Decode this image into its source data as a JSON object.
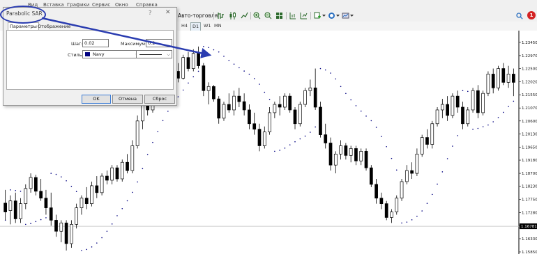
{
  "menu": [
    "Файл",
    "Вид",
    "Вставка",
    "Графики",
    "Сервис",
    "Окно",
    "Справка"
  ],
  "toolbar": {
    "autotrade_label": "Авто-торговля",
    "notification_badge": "1"
  },
  "timeframes": [
    {
      "label": "H4",
      "active": false
    },
    {
      "label": "D1",
      "active": true
    },
    {
      "label": "W1",
      "active": false
    },
    {
      "label": "MN",
      "active": false
    }
  ],
  "dialog": {
    "title": "Parabolic SAR",
    "help": "?",
    "tabs": [
      {
        "label": "Параметры",
        "active": true
      },
      {
        "label": "Отображение",
        "active": false
      }
    ],
    "step_label": "Шаг:",
    "step_value": "0.02",
    "maximum_label": "Максимум:",
    "maximum_value": "0.2",
    "style_label": "Стиль:",
    "color_value": "Navy",
    "color_hex": "#000080",
    "ok_label": "OK",
    "cancel_label": "Отмена",
    "reset_label": "Сброс"
  },
  "price_axis": {
    "labels": [
      "1.23450",
      "1.22970",
      "1.22500",
      "1.22020",
      "1.21550",
      "1.21070",
      "1.20600",
      "1.20130",
      "1.19650",
      "1.19180",
      "1.18700",
      "1.18230",
      "1.17750",
      "1.17280",
      "1.16800",
      "1.16330",
      "1.15850"
    ],
    "current_price": "1.16781"
  },
  "colors": {
    "bull_body": "#ffffff",
    "bear_body": "#000000",
    "sar_dots": "#000080",
    "annotation": "#2a3cb0"
  },
  "chart_data": {
    "type": "candlestick",
    "indicator": "Parabolic SAR",
    "candles": [
      {
        "o": 1.1762,
        "h": 1.181,
        "l": 1.17,
        "c": 1.173
      },
      {
        "o": 1.1735,
        "h": 1.179,
        "l": 1.1685,
        "c": 1.177
      },
      {
        "o": 1.177,
        "h": 1.18,
        "l": 1.169,
        "c": 1.1705
      },
      {
        "o": 1.1705,
        "h": 1.178,
        "l": 1.169,
        "c": 1.176
      },
      {
        "o": 1.176,
        "h": 1.183,
        "l": 1.174,
        "c": 1.1815
      },
      {
        "o": 1.1815,
        "h": 1.187,
        "l": 1.18,
        "c": 1.1855
      },
      {
        "o": 1.1855,
        "h": 1.1865,
        "l": 1.179,
        "c": 1.1805
      },
      {
        "o": 1.1805,
        "h": 1.185,
        "l": 1.177,
        "c": 1.178
      },
      {
        "o": 1.178,
        "h": 1.181,
        "l": 1.172,
        "c": 1.1745
      },
      {
        "o": 1.1745,
        "h": 1.18,
        "l": 1.168,
        "c": 1.17
      },
      {
        "o": 1.17,
        "h": 1.172,
        "l": 1.164,
        "c": 1.166
      },
      {
        "o": 1.166,
        "h": 1.17,
        "l": 1.162,
        "c": 1.169
      },
      {
        "o": 1.169,
        "h": 1.17,
        "l": 1.159,
        "c": 1.1615
      },
      {
        "o": 1.1615,
        "h": 1.17,
        "l": 1.16,
        "c": 1.1685
      },
      {
        "o": 1.1685,
        "h": 1.176,
        "l": 1.167,
        "c": 1.1745
      },
      {
        "o": 1.1745,
        "h": 1.179,
        "l": 1.172,
        "c": 1.178
      },
      {
        "o": 1.178,
        "h": 1.182,
        "l": 1.174,
        "c": 1.176
      },
      {
        "o": 1.176,
        "h": 1.184,
        "l": 1.175,
        "c": 1.1825
      },
      {
        "o": 1.1825,
        "h": 1.186,
        "l": 1.178,
        "c": 1.18
      },
      {
        "o": 1.18,
        "h": 1.187,
        "l": 1.179,
        "c": 1.186
      },
      {
        "o": 1.186,
        "h": 1.188,
        "l": 1.183,
        "c": 1.1845
      },
      {
        "o": 1.1845,
        "h": 1.19,
        "l": 1.183,
        "c": 1.189
      },
      {
        "o": 1.189,
        "h": 1.19,
        "l": 1.184,
        "c": 1.185
      },
      {
        "o": 1.185,
        "h": 1.192,
        "l": 1.184,
        "c": 1.191
      },
      {
        "o": 1.191,
        "h": 1.194,
        "l": 1.187,
        "c": 1.188
      },
      {
        "o": 1.188,
        "h": 1.199,
        "l": 1.187,
        "c": 1.197
      },
      {
        "o": 1.197,
        "h": 1.208,
        "l": 1.196,
        "c": 1.206
      },
      {
        "o": 1.206,
        "h": 1.214,
        "l": 1.203,
        "c": 1.212
      },
      {
        "o": 1.212,
        "h": 1.216,
        "l": 1.208,
        "c": 1.21
      },
      {
        "o": 1.21,
        "h": 1.218,
        "l": 1.209,
        "c": 1.217
      },
      {
        "o": 1.217,
        "h": 1.222,
        "l": 1.215,
        "c": 1.219
      },
      {
        "o": 1.219,
        "h": 1.223,
        "l": 1.212,
        "c": 1.214
      },
      {
        "o": 1.214,
        "h": 1.22,
        "l": 1.213,
        "c": 1.218
      },
      {
        "o": 1.218,
        "h": 1.225,
        "l": 1.217,
        "c": 1.224
      },
      {
        "o": 1.224,
        "h": 1.227,
        "l": 1.22,
        "c": 1.2215
      },
      {
        "o": 1.2215,
        "h": 1.23,
        "l": 1.221,
        "c": 1.229
      },
      {
        "o": 1.229,
        "h": 1.231,
        "l": 1.224,
        "c": 1.225
      },
      {
        "o": 1.225,
        "h": 1.232,
        "l": 1.224,
        "c": 1.2305
      },
      {
        "o": 1.2305,
        "h": 1.233,
        "l": 1.225,
        "c": 1.226
      },
      {
        "o": 1.226,
        "h": 1.227,
        "l": 1.215,
        "c": 1.217
      },
      {
        "o": 1.217,
        "h": 1.22,
        "l": 1.212,
        "c": 1.2185
      },
      {
        "o": 1.2185,
        "h": 1.219,
        "l": 1.213,
        "c": 1.214
      },
      {
        "o": 1.214,
        "h": 1.215,
        "l": 1.205,
        "c": 1.207
      },
      {
        "o": 1.207,
        "h": 1.213,
        "l": 1.206,
        "c": 1.212
      },
      {
        "o": 1.212,
        "h": 1.216,
        "l": 1.209,
        "c": 1.21
      },
      {
        "o": 1.21,
        "h": 1.217,
        "l": 1.208,
        "c": 1.215
      },
      {
        "o": 1.215,
        "h": 1.218,
        "l": 1.211,
        "c": 1.213
      },
      {
        "o": 1.213,
        "h": 1.216,
        "l": 1.208,
        "c": 1.21
      },
      {
        "o": 1.21,
        "h": 1.212,
        "l": 1.203,
        "c": 1.205
      },
      {
        "o": 1.205,
        "h": 1.209,
        "l": 1.201,
        "c": 1.203
      },
      {
        "o": 1.203,
        "h": 1.205,
        "l": 1.195,
        "c": 1.197
      },
      {
        "o": 1.197,
        "h": 1.204,
        "l": 1.196,
        "c": 1.202
      },
      {
        "o": 1.202,
        "h": 1.211,
        "l": 1.201,
        "c": 1.209
      },
      {
        "o": 1.209,
        "h": 1.213,
        "l": 1.207,
        "c": 1.212
      },
      {
        "o": 1.212,
        "h": 1.215,
        "l": 1.208,
        "c": 1.211
      },
      {
        "o": 1.211,
        "h": 1.216,
        "l": 1.21,
        "c": 1.215
      },
      {
        "o": 1.215,
        "h": 1.216,
        "l": 1.209,
        "c": 1.21
      },
      {
        "o": 1.21,
        "h": 1.211,
        "l": 1.203,
        "c": 1.205
      },
      {
        "o": 1.205,
        "h": 1.213,
        "l": 1.204,
        "c": 1.212
      },
      {
        "o": 1.212,
        "h": 1.218,
        "l": 1.211,
        "c": 1.217
      },
      {
        "o": 1.217,
        "h": 1.221,
        "l": 1.215,
        "c": 1.218
      },
      {
        "o": 1.218,
        "h": 1.225,
        "l": 1.21,
        "c": 1.211
      },
      {
        "o": 1.211,
        "h": 1.213,
        "l": 1.2,
        "c": 1.201
      },
      {
        "o": 1.201,
        "h": 1.205,
        "l": 1.196,
        "c": 1.198
      },
      {
        "o": 1.198,
        "h": 1.2,
        "l": 1.188,
        "c": 1.19
      },
      {
        "o": 1.19,
        "h": 1.195,
        "l": 1.187,
        "c": 1.194
      },
      {
        "o": 1.194,
        "h": 1.199,
        "l": 1.192,
        "c": 1.197
      },
      {
        "o": 1.197,
        "h": 1.198,
        "l": 1.192,
        "c": 1.1935
      },
      {
        "o": 1.1935,
        "h": 1.197,
        "l": 1.191,
        "c": 1.196
      },
      {
        "o": 1.196,
        "h": 1.197,
        "l": 1.19,
        "c": 1.1915
      },
      {
        "o": 1.1915,
        "h": 1.196,
        "l": 1.19,
        "c": 1.195
      },
      {
        "o": 1.195,
        "h": 1.196,
        "l": 1.188,
        "c": 1.189
      },
      {
        "o": 1.189,
        "h": 1.19,
        "l": 1.182,
        "c": 1.183
      },
      {
        "o": 1.183,
        "h": 1.185,
        "l": 1.176,
        "c": 1.178
      },
      {
        "o": 1.178,
        "h": 1.18,
        "l": 1.174,
        "c": 1.176
      },
      {
        "o": 1.176,
        "h": 1.177,
        "l": 1.17,
        "c": 1.171
      },
      {
        "o": 1.171,
        "h": 1.174,
        "l": 1.169,
        "c": 1.173
      },
      {
        "o": 1.173,
        "h": 1.179,
        "l": 1.172,
        "c": 1.178
      },
      {
        "o": 1.178,
        "h": 1.185,
        "l": 1.177,
        "c": 1.184
      },
      {
        "o": 1.184,
        "h": 1.19,
        "l": 1.183,
        "c": 1.188
      },
      {
        "o": 1.188,
        "h": 1.191,
        "l": 1.185,
        "c": 1.187
      },
      {
        "o": 1.187,
        "h": 1.196,
        "l": 1.186,
        "c": 1.194
      },
      {
        "o": 1.194,
        "h": 1.201,
        "l": 1.193,
        "c": 1.2
      },
      {
        "o": 1.2,
        "h": 1.203,
        "l": 1.196,
        "c": 1.1975
      },
      {
        "o": 1.1975,
        "h": 1.206,
        "l": 1.196,
        "c": 1.205
      },
      {
        "o": 1.205,
        "h": 1.211,
        "l": 1.204,
        "c": 1.21
      },
      {
        "o": 1.21,
        "h": 1.214,
        "l": 1.207,
        "c": 1.212
      },
      {
        "o": 1.212,
        "h": 1.215,
        "l": 1.206,
        "c": 1.208
      },
      {
        "o": 1.208,
        "h": 1.216,
        "l": 1.207,
        "c": 1.215
      },
      {
        "o": 1.215,
        "h": 1.217,
        "l": 1.209,
        "c": 1.211
      },
      {
        "o": 1.211,
        "h": 1.213,
        "l": 1.203,
        "c": 1.205
      },
      {
        "o": 1.205,
        "h": 1.211,
        "l": 1.204,
        "c": 1.21
      },
      {
        "o": 1.21,
        "h": 1.218,
        "l": 1.209,
        "c": 1.217
      },
      {
        "o": 1.217,
        "h": 1.219,
        "l": 1.207,
        "c": 1.209
      },
      {
        "o": 1.209,
        "h": 1.217,
        "l": 1.208,
        "c": 1.216
      },
      {
        "o": 1.216,
        "h": 1.224,
        "l": 1.215,
        "c": 1.223
      },
      {
        "o": 1.223,
        "h": 1.225,
        "l": 1.216,
        "c": 1.218
      },
      {
        "o": 1.218,
        "h": 1.226,
        "l": 1.217,
        "c": 1.225
      },
      {
        "o": 1.225,
        "h": 1.227,
        "l": 1.219,
        "c": 1.22
      },
      {
        "o": 1.22,
        "h": 1.226,
        "l": 1.218,
        "c": 1.223
      },
      {
        "o": 1.223,
        "h": 1.225,
        "l": 1.215,
        "c": 1.22
      }
    ],
    "y_range": [
      1.1585,
      1.2375
    ],
    "grid": false,
    "current_price": 1.16781
  }
}
